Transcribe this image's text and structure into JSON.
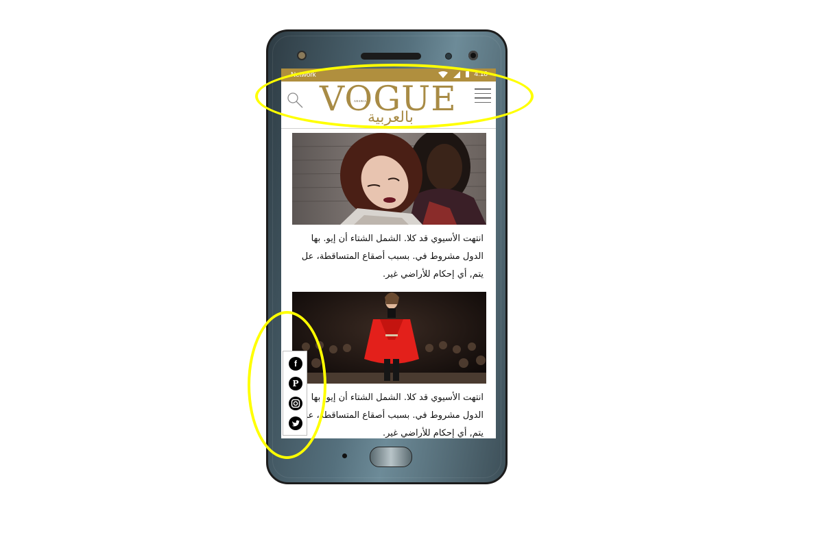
{
  "status_bar": {
    "network": "Network",
    "time": "4:18",
    "background_color": "#b08f3e"
  },
  "header": {
    "logo_main": "VOGUE",
    "logo_small": "ARABIA",
    "logo_arabic": "بالعربية",
    "brand_color": "#a88b45",
    "left_icon": "search-icon",
    "right_icon": "menu-icon"
  },
  "articles": [
    {
      "image": "two-women-portrait",
      "text": "انتهت الأسيوي قد كلا. الشمل الشتاء أن إيو. بها الدول مشروط في. بسبب أصقاع المتساقطة، عل يتم, أي إحكام للأراضي غير."
    },
    {
      "image": "runway-model-red-cape",
      "text": "انتهت الأسيوي قد كلا. الشمل الشتاء أن إيو. بها الدول مشروط في. بسبب أصقاع المتساقطة، عل يتم, أي إحكام للأراضي غير."
    }
  ],
  "social": [
    {
      "icon": "facebook-icon",
      "glyph": "f"
    },
    {
      "icon": "pinterest-icon",
      "glyph": "P"
    },
    {
      "icon": "instagram-icon",
      "glyph": ""
    },
    {
      "icon": "twitter-icon",
      "glyph": ""
    }
  ],
  "highlight_color": "#ffff00"
}
